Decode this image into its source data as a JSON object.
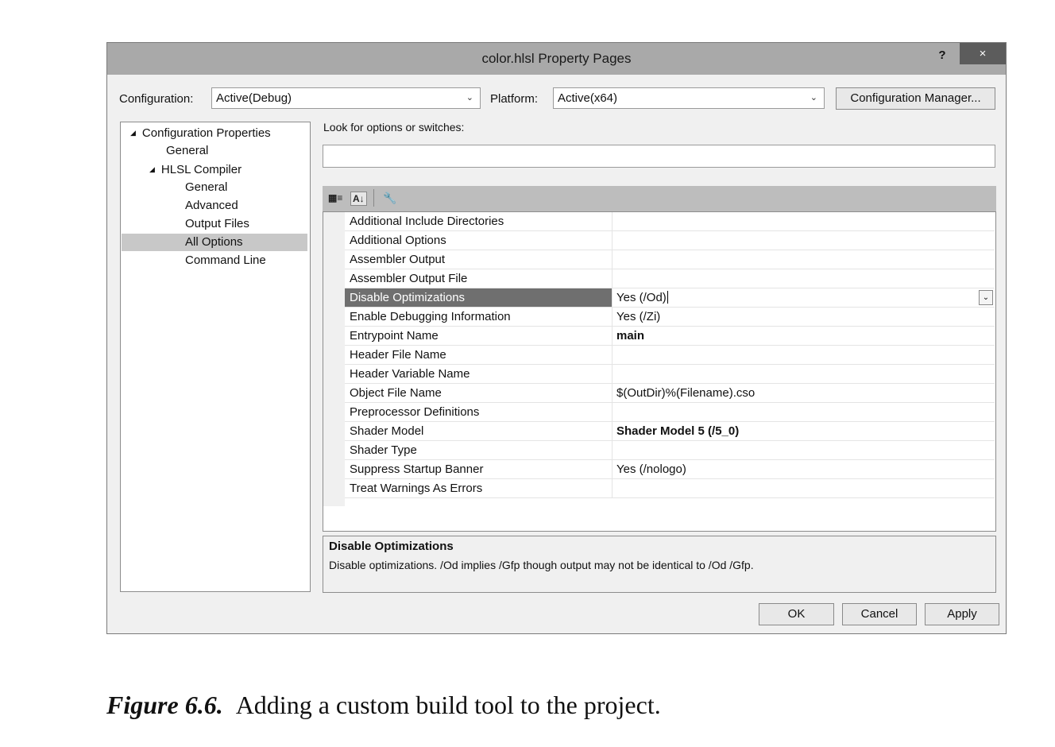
{
  "window": {
    "title": "color.hlsl Property Pages",
    "help": "?",
    "close": "×"
  },
  "config": {
    "label": "Configuration:",
    "value": "Active(Debug)",
    "platform_label": "Platform:",
    "platform_value": "Active(x64)",
    "manager_label": "Configuration Manager..."
  },
  "tree": {
    "root": "Configuration Properties",
    "general": "General",
    "compiler": "HLSL Compiler",
    "children": [
      "General",
      "Advanced",
      "Output Files",
      "All Options",
      "Command Line"
    ],
    "selected": "All Options"
  },
  "search": {
    "label": "Look for options or switches:",
    "value": ""
  },
  "grid": {
    "rows": [
      {
        "name": "Additional Include Directories",
        "value": ""
      },
      {
        "name": "Additional Options",
        "value": ""
      },
      {
        "name": "Assembler Output",
        "value": ""
      },
      {
        "name": "Assembler Output File",
        "value": ""
      },
      {
        "name": "Disable Optimizations",
        "value": "Yes (/Od)"
      },
      {
        "name": "Enable Debugging Information",
        "value": "Yes (/Zi)"
      },
      {
        "name": "Entrypoint Name",
        "value": "main"
      },
      {
        "name": "Header File Name",
        "value": ""
      },
      {
        "name": "Header Variable Name",
        "value": ""
      },
      {
        "name": "Object File Name",
        "value": "$(OutDir)%(Filename).cso"
      },
      {
        "name": "Preprocessor Definitions",
        "value": ""
      },
      {
        "name": "Shader Model",
        "value": "Shader Model 5 (/5_0)"
      },
      {
        "name": "Shader Type",
        "value": ""
      },
      {
        "name": "Suppress Startup Banner",
        "value": "Yes (/nologo)"
      },
      {
        "name": "Treat Warnings As Errors",
        "value": ""
      }
    ],
    "selected_row": "Disable Optimizations"
  },
  "description": {
    "title": "Disable Optimizations",
    "text": "Disable optimizations. /Od implies /Gfp though output may not be identical to /Od /Gfp."
  },
  "buttons": {
    "ok": "OK",
    "cancel": "Cancel",
    "apply": "Apply"
  },
  "caption": {
    "label": "Figure 6.6.",
    "text": "Adding a custom build tool to the project."
  }
}
